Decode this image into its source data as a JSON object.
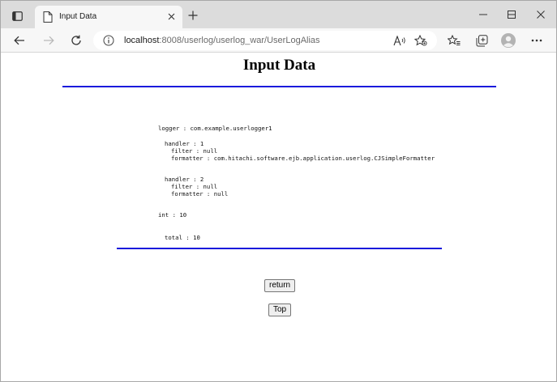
{
  "browser": {
    "tab": {
      "title": "Input Data"
    },
    "address": {
      "host": "localhost",
      "path": ":8008/userlog/userlog_war/UserLogAlias"
    }
  },
  "page": {
    "heading": "Input Data",
    "log_lines": {
      "logger": "logger : com.example.userlogger1",
      "h1_handler": "handler : 1",
      "h1_filter": "filter : null",
      "h1_formatter": "formatter : com.hitachi.software.ejb.application.userlog.CJSimpleFormatter",
      "h2_handler": "handler : 2",
      "h2_filter": "filter : null",
      "h2_formatter": "formatter : null",
      "int": "int : 10",
      "total": "total : 10"
    },
    "buttons": {
      "return_label": "return",
      "top_label": "Top"
    }
  }
}
